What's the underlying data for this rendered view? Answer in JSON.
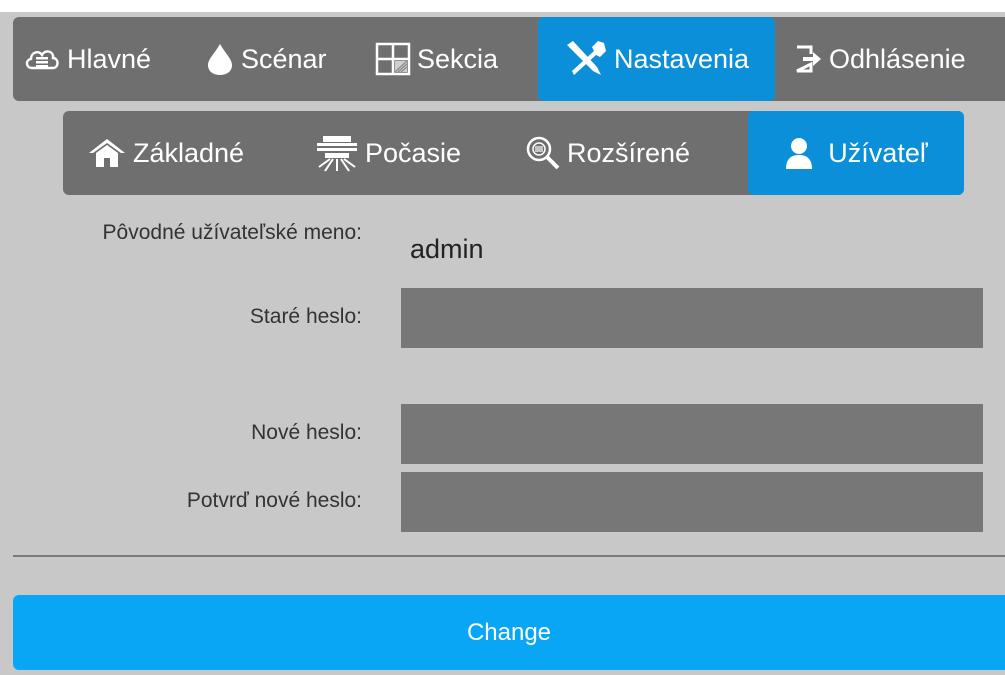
{
  "main_nav": {
    "tabs": [
      {
        "label": "Hlavné",
        "icon": "cloud-icon"
      },
      {
        "label": "Scénar",
        "icon": "drop-icon"
      },
      {
        "label": "Sekcia",
        "icon": "grid-icon"
      },
      {
        "label": "Nastavenia",
        "icon": "tools-icon",
        "active": true
      },
      {
        "label": "Odhlásenie",
        "icon": "logout-icon"
      }
    ]
  },
  "sub_nav": {
    "tabs": [
      {
        "label": "Základné",
        "icon": "home-icon"
      },
      {
        "label": "Počasie",
        "icon": "sprinkler-icon"
      },
      {
        "label": "Rozšírené",
        "icon": "magnifier-icon"
      },
      {
        "label": "Užívateľ",
        "icon": "user-icon",
        "active": true
      }
    ]
  },
  "form": {
    "original_username_label": "Pôvodné užívateľské meno:",
    "original_username_value": "admin",
    "old_password_label": "Staré heslo:",
    "new_password_label": "Nové heslo:",
    "confirm_password_label": "Potvrď nové heslo:"
  },
  "change_button_label": "Change",
  "colors": {
    "active": "#0a8fd8",
    "nav_bg": "#6f6f6f",
    "page_bg": "#c8c8c8",
    "button": "#09a6f5",
    "field": "#777777"
  }
}
